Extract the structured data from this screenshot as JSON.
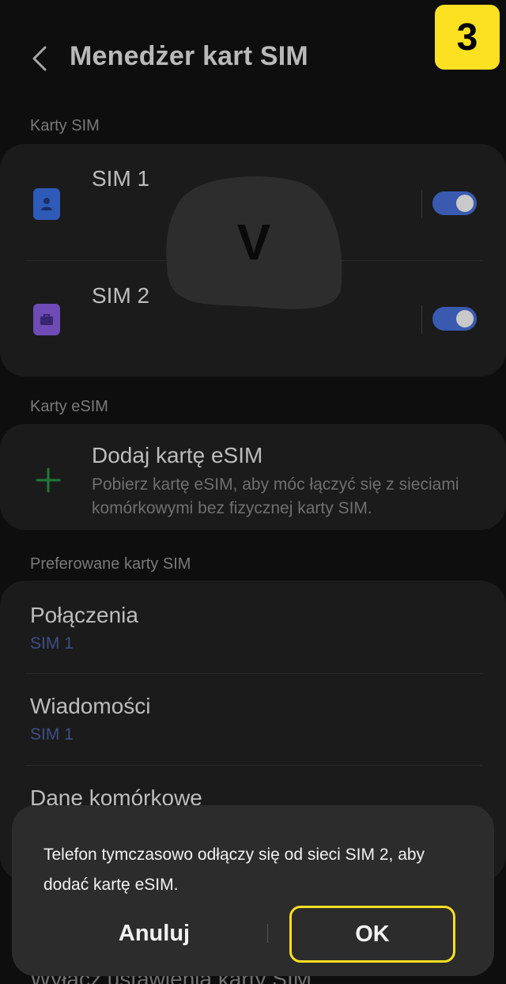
{
  "header": {
    "title": "Menedżer kart SIM",
    "step_badge": "3"
  },
  "sections": {
    "sim_cards": "Karty SIM",
    "esim_cards": "Karty eSIM",
    "preferred": "Preferowane karty SIM"
  },
  "sims": [
    {
      "name": "SIM 1",
      "enabled": true,
      "icon": "person-sim-icon",
      "color": "#2f5bb8"
    },
    {
      "name": "SIM 2",
      "enabled": true,
      "icon": "briefcase-sim-icon",
      "color": "#6e4bb5"
    }
  ],
  "overlay": {
    "letter": "V"
  },
  "esim": {
    "title": "Dodaj kartę eSIM",
    "description": "Pobierz kartę eSIM, aby móc łączyć się z sieciami komórkowymi bez fizycznej karty SIM."
  },
  "preferred": [
    {
      "title": "Połączenia",
      "value": "SIM 1"
    },
    {
      "title": "Wiadomości",
      "value": "SIM 1"
    },
    {
      "title": "Dane komórkowe"
    }
  ],
  "dialog": {
    "message": "Telefon tymczasowo odłączy się od sieci SIM 2, aby dodać kartę eSIM.",
    "cancel_label": "Anuluj",
    "ok_label": "OK"
  },
  "bottom_partial": "Wyłącz ustawienia karty SIM",
  "colors": {
    "accent": "#fce022",
    "toggle_on": "#3a5ab0",
    "esim_plus": "#1e7a3a"
  }
}
